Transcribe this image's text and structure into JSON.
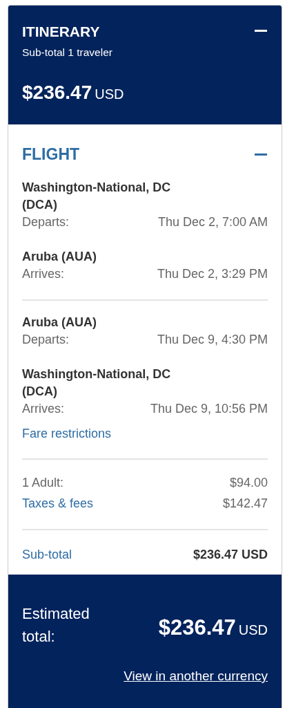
{
  "header": {
    "title": "ITINERARY",
    "subtitle": "Sub-total 1 traveler",
    "price": "$236.47",
    "currency": "USD",
    "expanded": true
  },
  "flight": {
    "title": "FLIGHT",
    "expanded": true,
    "segments": [
      {
        "stops": [
          {
            "airport": "Washington-National, DC (DCA)",
            "label": "Departs:",
            "time": "Thu Dec 2, 7:00 AM"
          },
          {
            "airport": "Aruba (AUA)",
            "label": "Arrives:",
            "time": "Thu Dec 2, 3:29 PM"
          }
        ]
      },
      {
        "stops": [
          {
            "airport": "Aruba (AUA)",
            "label": "Departs:",
            "time": "Thu Dec 9, 4:30 PM"
          },
          {
            "airport": "Washington-National, DC (DCA)",
            "label": "Arrives:",
            "time": "Thu Dec 9, 10:56 PM"
          }
        ]
      }
    ],
    "fare_link": "Fare restrictions",
    "charges": [
      {
        "label": "1 Adult:",
        "amount": "$94.00",
        "kind": "text"
      },
      {
        "label": "Taxes & fees",
        "amount": "$142.47",
        "kind": "link"
      }
    ],
    "subtotal": {
      "label": "Sub-total",
      "amount": "$236.47 USD"
    }
  },
  "footer": {
    "label": "Estimated total:",
    "price": "$236.47",
    "currency": "USD",
    "link": "View in another currency"
  }
}
